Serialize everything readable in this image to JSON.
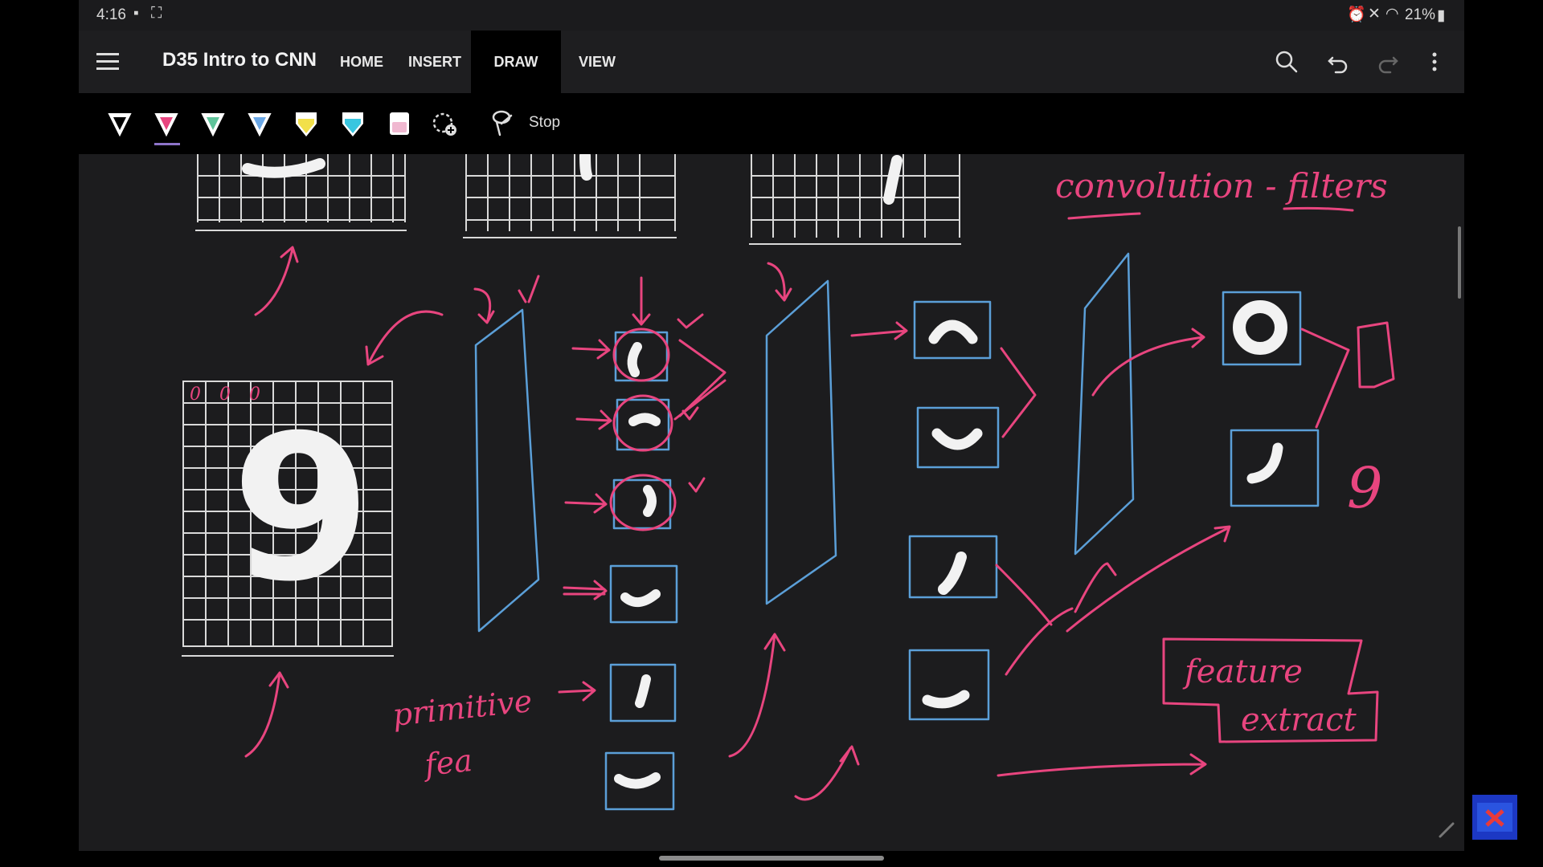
{
  "status": {
    "time": "4:16",
    "battery": "21%"
  },
  "app": {
    "title": "D35 Intro to CNN",
    "tabs": [
      {
        "label": "HOME",
        "active": false
      },
      {
        "label": "INSERT",
        "active": false
      },
      {
        "label": "DRAW",
        "active": true
      },
      {
        "label": "VIEW",
        "active": false
      }
    ],
    "actions": [
      "search-icon",
      "undo-icon",
      "redo-icon",
      "more-icon"
    ]
  },
  "toolbar": {
    "pens": [
      {
        "name": "pen-white",
        "color": "#ffffff"
      },
      {
        "name": "pen-pink",
        "color": "#e8457f"
      },
      {
        "name": "pen-green",
        "color": "#5fc49a"
      },
      {
        "name": "pen-blue",
        "color": "#6aa7e6"
      },
      {
        "name": "highlighter-yellow",
        "color": "#f2e04a"
      },
      {
        "name": "highlighter-cyan",
        "color": "#39c6e0"
      },
      {
        "name": "eraser",
        "color": "#f0b8d0"
      }
    ],
    "stop_label": "Stop"
  },
  "canvas": {
    "annotations": {
      "title": "convolution - filters",
      "primitive": "primitive",
      "fea": "fea",
      "feature": "feature",
      "extract": "extract",
      "zeros": "0 0 0",
      "digit": "9",
      "output_digit": "9"
    },
    "colors": {
      "pink_ink": "#e8457f",
      "blue_ink": "#5b9fd8",
      "white_ink": "#f2f2f2",
      "background": "#1c1c1e"
    }
  }
}
